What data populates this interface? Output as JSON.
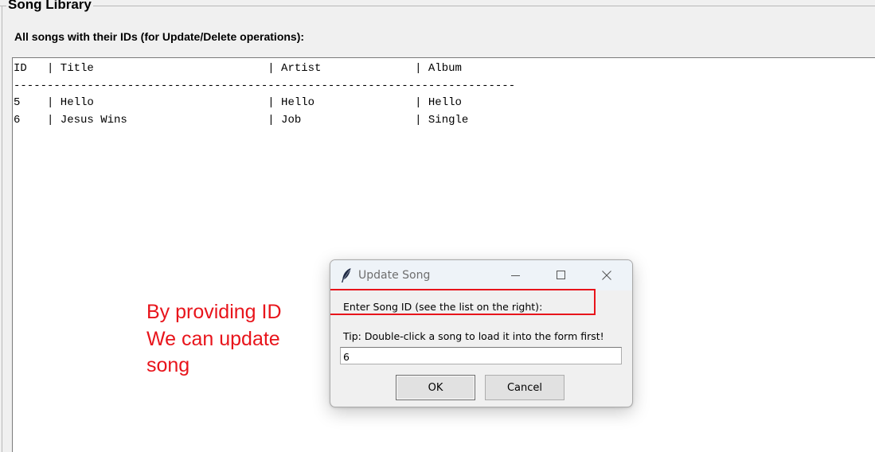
{
  "library": {
    "title": "Song Library",
    "subtitle": "All songs with their IDs (for Update/Delete operations):",
    "listing_text": "ID   | Title                          | Artist              | Album\n---------------------------------------------------------------------------\n5    | Hello                          | Hello               | Hello\n6    | Jesus Wins                     | Job                 | Single"
  },
  "annotation": {
    "lines": [
      "By providing ID",
      "We can update",
      "song"
    ],
    "color": "#e8141b"
  },
  "dialog": {
    "title": "Update Song",
    "app_icon": "feather-icon",
    "window_buttons": [
      "minimize-icon",
      "maximize-icon",
      "close-icon"
    ],
    "prompt": "Enter Song ID (see the list on the right):",
    "tip": "Tip: Double-click a song to load it into the form first!",
    "input_value": "6",
    "ok_label": "OK",
    "cancel_label": "Cancel",
    "highlight_color": "#e8141b"
  }
}
